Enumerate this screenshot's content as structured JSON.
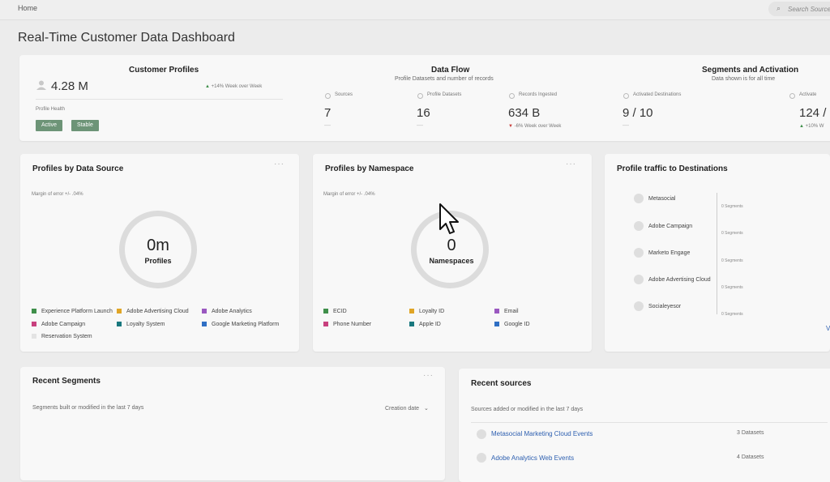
{
  "topbar": {
    "breadcrumb": "Home",
    "search_placeholder": "Search Sources"
  },
  "page_title": "Real-Time Customer Data Dashboard",
  "summary": {
    "customer_profiles": {
      "title": "Customer Profiles",
      "count": "4.28 M",
      "trend": "+14% Week over Week",
      "health_label": "Profile Health",
      "badges": [
        "Active",
        "Stable"
      ]
    },
    "data_flow": {
      "title": "Data Flow",
      "subtitle": "Profile Datasets and number of records",
      "stats": [
        {
          "label": "Sources",
          "value": "7",
          "note": "—"
        },
        {
          "label": "Profile Datasets",
          "value": "16",
          "note": "—"
        },
        {
          "label": "Records Ingested",
          "value": "634 B",
          "note": "-6% Week over Week"
        }
      ]
    },
    "segments_activation": {
      "title": "Segments and Activation",
      "subtitle": "Data shown is for all time",
      "stats": [
        {
          "label": "Activated Destinations",
          "value": "9 / 10",
          "note": "—"
        },
        {
          "label": "Activate",
          "value": "124 /",
          "note": "+10% W"
        }
      ]
    }
  },
  "profiles_by_source": {
    "title": "Profiles by Data Source",
    "margin": "Margin of error +/- .04%",
    "value": "0m",
    "value_label": "Profiles",
    "legend": [
      {
        "label": "Experience Platform Launch",
        "color": "#3f8f4a"
      },
      {
        "label": "Adobe Advertising Cloud",
        "color": "#e0a526"
      },
      {
        "label": "Adobe Analytics",
        "color": "#9a58c0"
      },
      {
        "label": "Adobe Campaign",
        "color": "#c8407e"
      },
      {
        "label": "Loyalty System",
        "color": "#19787e"
      },
      {
        "label": "Google Marketing Platform",
        "color": "#2f6fc4"
      },
      {
        "label": "Reservation System",
        "color": "#e3e3e3"
      }
    ]
  },
  "profiles_by_namespace": {
    "title": "Profiles by Namespace",
    "margin": "Margin of error +/- .04%",
    "value": "0",
    "value_label": "Namespaces",
    "legend": [
      {
        "label": "ECID",
        "color": "#3f8f4a"
      },
      {
        "label": "Loyalty ID",
        "color": "#e0a526"
      },
      {
        "label": "Email",
        "color": "#9a58c0"
      },
      {
        "label": "Phone Number",
        "color": "#c8407e"
      },
      {
        "label": "Apple ID",
        "color": "#19787e"
      },
      {
        "label": "Google ID",
        "color": "#2f6fc4"
      }
    ]
  },
  "profile_traffic": {
    "title": "Profile traffic to Destinations",
    "destinations": [
      {
        "name": "Metasocial",
        "segments": "0 Segments"
      },
      {
        "name": "Adobe Campaign",
        "segments": "0 Segments"
      },
      {
        "name": "Marketo Engage",
        "segments": "0 Segments"
      },
      {
        "name": "Adobe Advertising Cloud",
        "segments": "0 Segments"
      },
      {
        "name": "Socialeyesor",
        "segments": "0 Segments"
      }
    ],
    "view_more": "V"
  },
  "recent_segments": {
    "title": "Recent Segments",
    "subtitle": "Segments built or modified in the last 7 days",
    "sort_label": "Creation date"
  },
  "recent_sources": {
    "title": "Recent sources",
    "subtitle": "Sources added or modified in the last 7 days",
    "items": [
      {
        "name": "Metasocial Marketing Cloud Events",
        "datasets": "3 Datasets"
      },
      {
        "name": "Adobe Analytics Web Events",
        "datasets": "4 Datasets"
      }
    ]
  }
}
